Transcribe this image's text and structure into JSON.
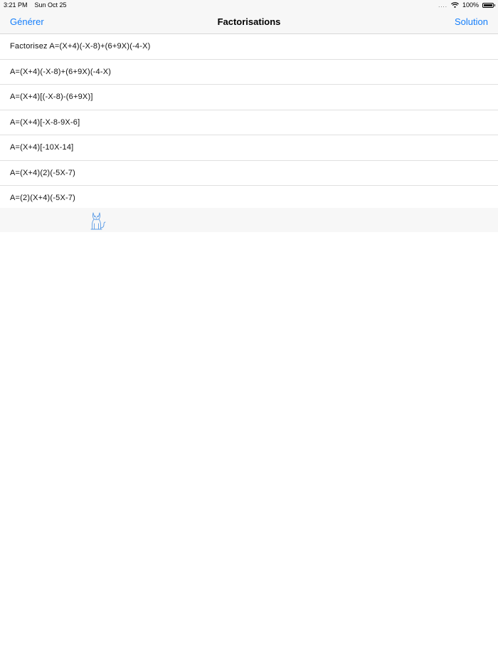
{
  "status_bar": {
    "time": "3:21 PM",
    "date": "Sun Oct 25",
    "signal": "....",
    "battery_text": "100%",
    "battery_level": 1.0
  },
  "nav": {
    "left_button": "Générer",
    "title": "Factorisations",
    "right_button": "Solution",
    "accent_color": "#147efb"
  },
  "rows": [
    "Factorisez A=(X+4)(-X-8)+(6+9X)(-4-X)",
    "A=(X+4)(-X-8)+(6+9X)(-4-X)",
    "A=(X+4)[(-X-8)-(6+9X)]",
    "A=(X+4)[-X-8-9X-6]",
    "A=(X+4)[-10X-14]",
    "A=(X+4)(2)(-5X-7)",
    "A=(2)(X+4)(-5X-7)"
  ],
  "footer": {
    "icon": "cat-icon"
  }
}
